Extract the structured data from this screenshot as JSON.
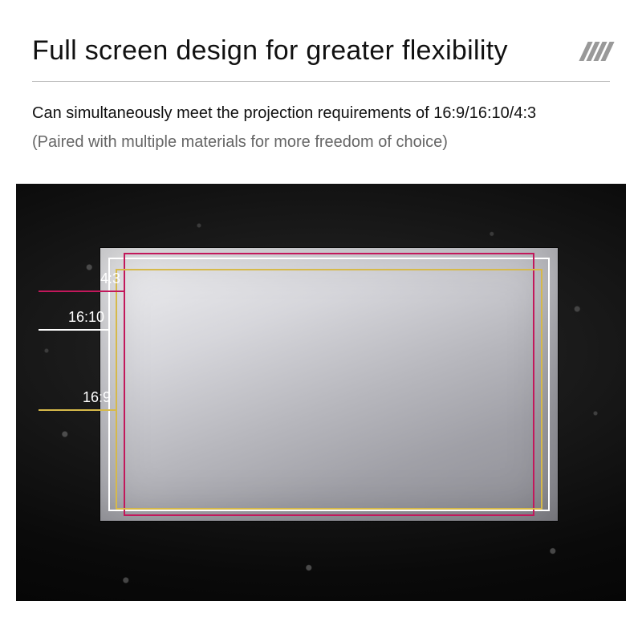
{
  "header": {
    "title": "Full screen design for greater flexibility",
    "subtitle": "Can simultaneously meet the projection requirements of 16:9/16:10/4:3",
    "paren": "(Paired with multiple materials for more freedom of choice)"
  },
  "ratios": {
    "r43": {
      "label": "4:3"
    },
    "r1610": {
      "label": "16:10"
    },
    "r169": {
      "label": "16:9"
    }
  },
  "colors": {
    "ratio_4_3": "#c2185b",
    "ratio_16_10": "#ffffff",
    "ratio_16_9": "#d6b94a"
  }
}
